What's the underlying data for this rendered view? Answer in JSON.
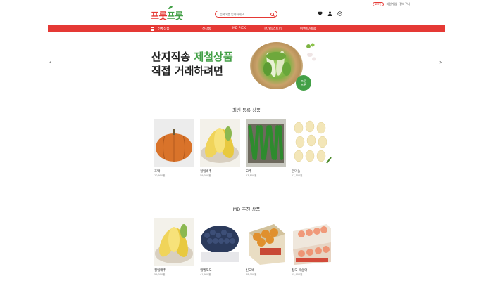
{
  "header": {
    "util_links": [
      "로그인",
      "회원가입",
      "장바구니"
    ],
    "logo": {
      "part1": "프룻",
      "part2": "프룻"
    },
    "search": {
      "placeholder": "검색어를 입력하세요"
    }
  },
  "nav": {
    "items": [
      "전체상품",
      "신상품",
      "MD PICK",
      "한가득스토어",
      "이벤트/혜택"
    ]
  },
  "banner": {
    "line1_prefix": "산지직송 ",
    "line1_highlight": "제철상품",
    "line2": "직접 거래하려면",
    "badge": [
      "프룻",
      "프룻"
    ]
  },
  "sections": [
    {
      "title": "최신 등록 상품",
      "products": [
        {
          "name": "호박",
          "price": "10,900원",
          "image": "pumpkin"
        },
        {
          "name": "절임배추",
          "price": "59,000원",
          "image": "cabbage"
        },
        {
          "name": "고추",
          "price": "23,800원",
          "image": "pepper"
        },
        {
          "name": "깐마늘",
          "price": "27,100원",
          "image": "garlic"
        }
      ]
    },
    {
      "title": "MD 추천 상품",
      "products": [
        {
          "name": "절임배추",
          "price": "59,000원",
          "image": "cabbage"
        },
        {
          "name": "캠벨포도",
          "price": "41,900원",
          "image": "grape"
        },
        {
          "name": "신고배",
          "price": "68,000원",
          "image": "pear"
        },
        {
          "name": "청도 복숭아",
          "price": "15,900원",
          "image": "peach"
        }
      ]
    }
  ],
  "colors": {
    "accent": "#e53935",
    "green": "#43a047"
  }
}
